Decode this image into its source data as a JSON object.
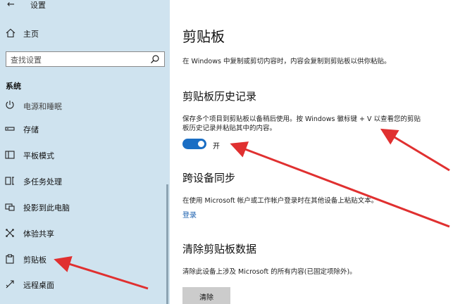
{
  "window": {
    "title": "设置"
  },
  "sidebar": {
    "home_label": "主页",
    "search_placeholder": "查找设置",
    "section_label": "系统",
    "items": [
      {
        "label": "电源和睡眠",
        "icon": "power-icon"
      },
      {
        "label": "存储",
        "icon": "storage-icon"
      },
      {
        "label": "平板模式",
        "icon": "tablet-icon"
      },
      {
        "label": "多任务处理",
        "icon": "multitask-icon"
      },
      {
        "label": "投影到此电脑",
        "icon": "project-icon"
      },
      {
        "label": "体验共享",
        "icon": "share-icon"
      },
      {
        "label": "剪贴板",
        "icon": "clipboard-icon"
      },
      {
        "label": "远程桌面",
        "icon": "remote-desktop-icon"
      }
    ]
  },
  "main": {
    "title": "剪贴板",
    "intro": "在 Windows 中复制或剪切内容时，内容会复制到剪贴板以供你粘贴。",
    "history": {
      "heading": "剪贴板历史记录",
      "description": "保存多个项目到剪贴板以备稍后使用。按 Windows 徽标键 + V 以查看您的剪贴板历史记录并粘贴其中的内容。",
      "toggle_label": "开"
    },
    "sync": {
      "heading": "跨设备同步",
      "description": "在使用 Microsoft 帐户或工作帐户登录时在其他设备上粘贴文本。",
      "link": "登录"
    },
    "clear": {
      "heading": "清除剪贴板数据",
      "description": "清除此设备上涉及 Microsoft 的所有内容(已固定项除外)。",
      "button": "清除"
    }
  },
  "colors": {
    "sidebar_bg": "#cfe3ef",
    "accent": "#1a6ec4",
    "annotation": "#e03030"
  }
}
